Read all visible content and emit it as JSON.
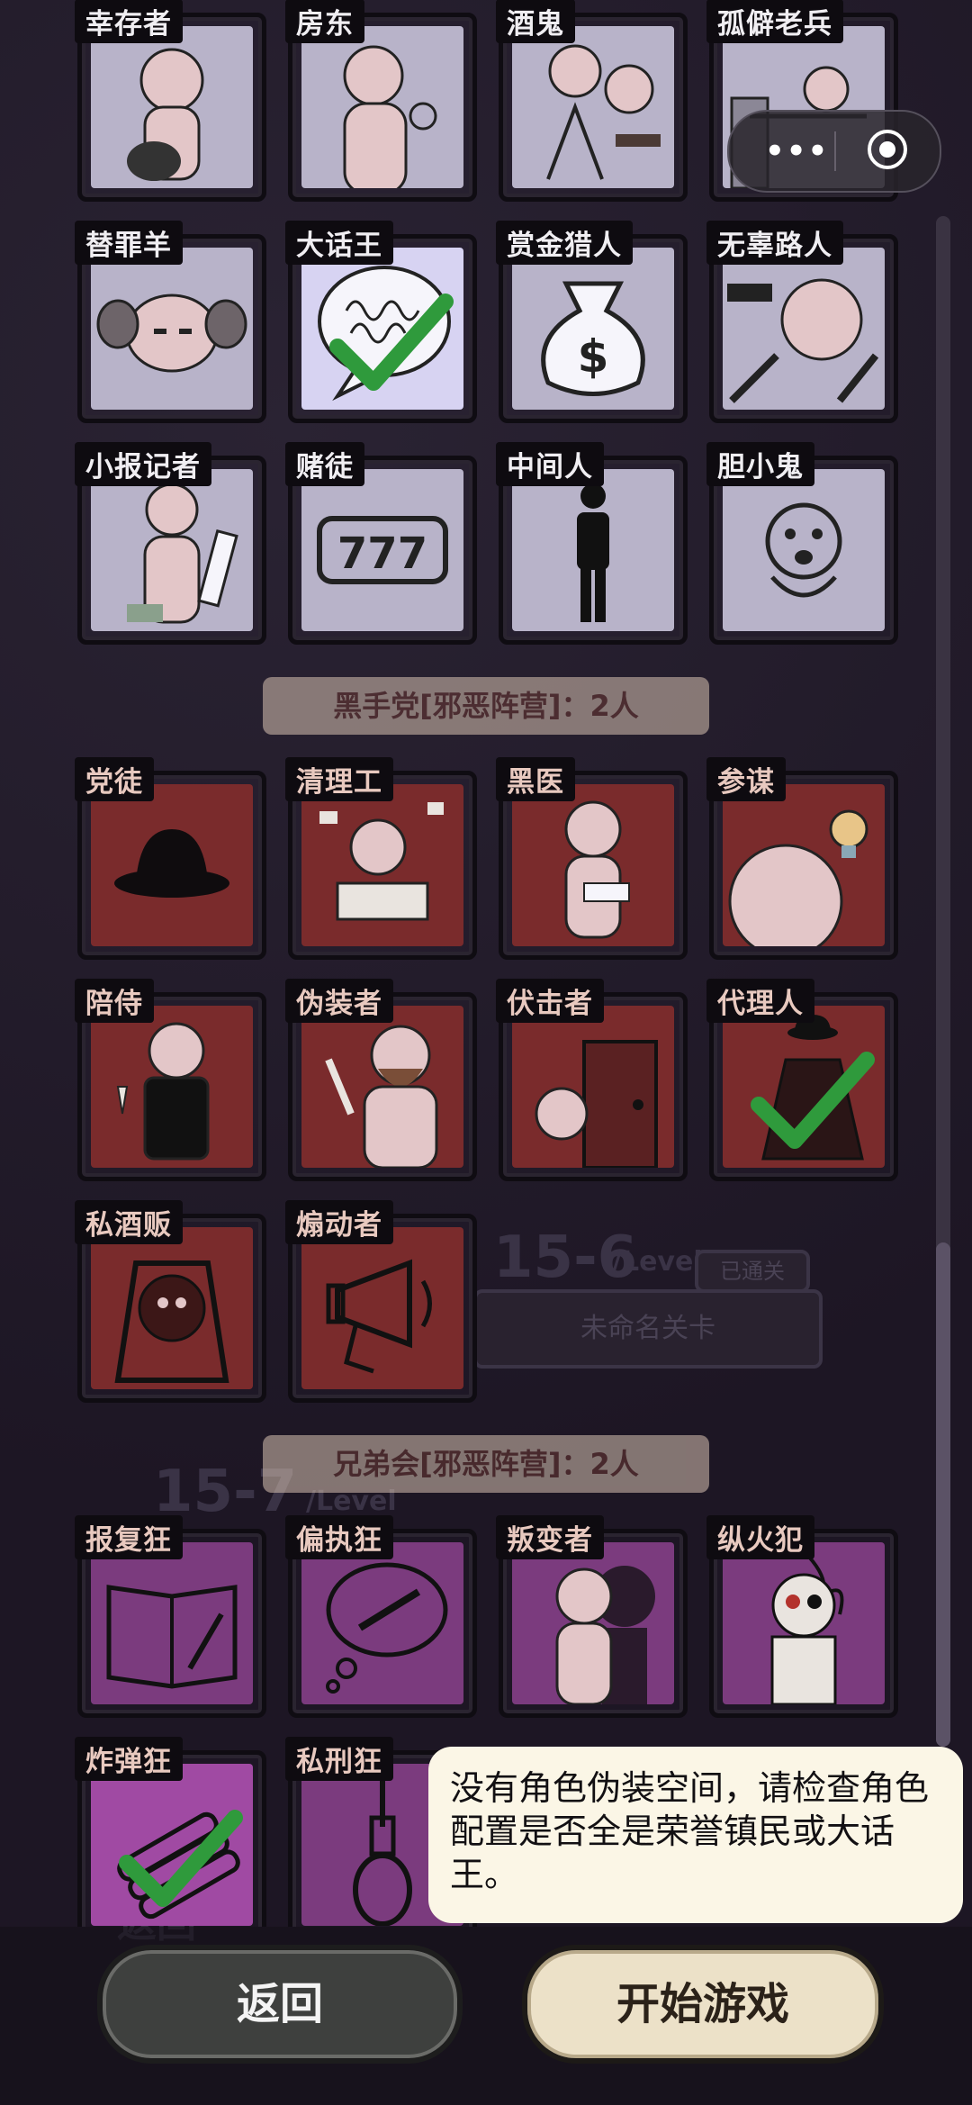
{
  "background": {
    "level_a": "15-6",
    "level_a_suffix": "/Level",
    "level_a_badge": "已通关",
    "level_a_card": "未命名关卡",
    "level_b": "15-7",
    "level_b_suffix": "/Level",
    "bottom_back": "返回"
  },
  "sections": {
    "hand": "黑手党[邪恶阵营]：2人",
    "bro": "兄弟会[邪恶阵营]：2人"
  },
  "roles": {
    "town": [
      "幸存者",
      "房东",
      "酒鬼",
      "孤僻老兵",
      "替罪羊",
      "大话王",
      "赏金猎人",
      "无辜路人",
      "小报记者",
      "赌徒",
      "中间人",
      "胆小鬼"
    ],
    "hand": [
      "党徒",
      "清理工",
      "黑医",
      "参谋",
      "陪侍",
      "伪装者",
      "伏击者",
      "代理人",
      "私酒贩",
      "煽动者"
    ],
    "bro": [
      "报复狂",
      "偏执狂",
      "叛变者",
      "纵火犯",
      "炸弹狂",
      "私刑狂"
    ]
  },
  "art": {
    "slot_machine": "777",
    "money_bag": "$"
  },
  "selected": [
    "大话王",
    "代理人",
    "炸弹狂"
  ],
  "capsule": {
    "more": "•••"
  },
  "toast": {
    "message": "没有角色伪装空间，请检查角色配置是否全是荣誉镇民或大话王。"
  },
  "buttons": {
    "back": "返回",
    "start": "开始游戏"
  },
  "colors": {
    "town": "#b8b3c9",
    "hand": "#7a2b2c",
    "bro": "#7b3b7e",
    "check": "#2f9a3c"
  }
}
